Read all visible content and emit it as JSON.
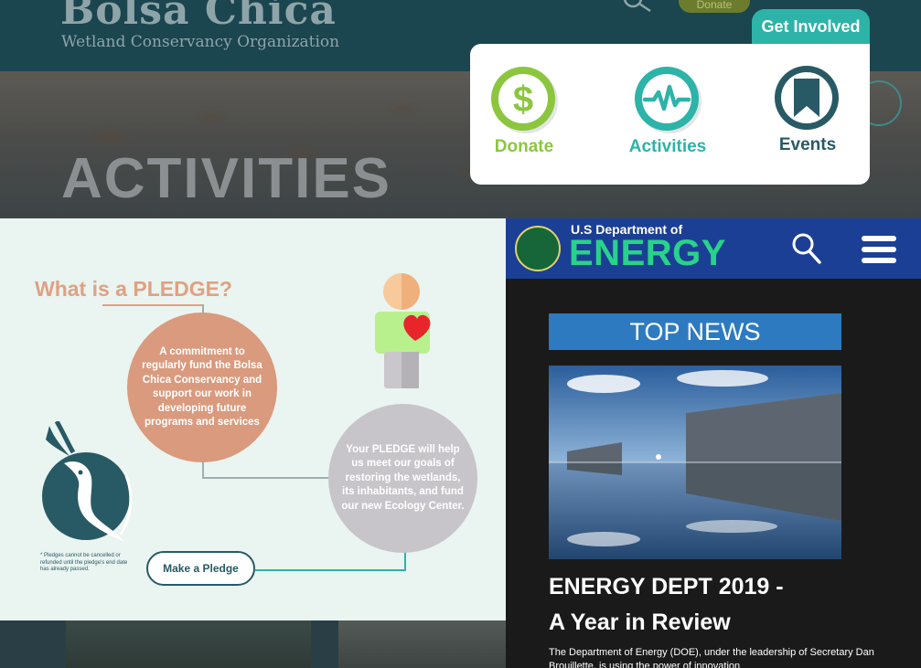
{
  "header": {
    "logo_main": "Bolsa Chica",
    "logo_sub": "Wetland Conservancy Organization",
    "donate_label": "Donate"
  },
  "hero": {
    "title": "ACTIVITIES"
  },
  "get_involved": {
    "tab_label": "Get Involved",
    "items": [
      {
        "label": "Donate",
        "icon": "dollar-icon",
        "color": "#8cc63f"
      },
      {
        "label": "Activities",
        "icon": "pulse-icon",
        "color": "#2db3a8"
      },
      {
        "label": "Events",
        "icon": "bookmark-icon",
        "color": "#285a65"
      }
    ]
  },
  "pledge": {
    "title": "What is a PLEDGE?",
    "circle_a": "A commitment to regularly fund the Bolsa Chica Conservancy and support our work in developing future programs and services",
    "circle_b": "Your PLEDGE will help us meet our goals of restoring the wetlands, its inhabitants, and fund our new Ecology Center.",
    "note": "* Pledges cannot be cancelled or refunded until the pledge's end date has already passed.",
    "button": "Make a Pledge",
    "colors": {
      "accent": "#d99a7e",
      "secondary": "#c7c5ca",
      "brand": "#285a65"
    }
  },
  "doe": {
    "small_title": "U.S Department of",
    "big_title": "ENERGY",
    "section_label": "TOP NEWS",
    "headline_line1": "ENERGY DEPT 2019 -",
    "headline_line2": "A Year in Review",
    "body": "The Department of Energy (DOE), under the leadership of Secretary Dan Brouillette, is using the power of innovation",
    "colors": {
      "bar": "#1b3f95",
      "energy_text": "#29d28a",
      "section": "#2d7ac0"
    }
  }
}
